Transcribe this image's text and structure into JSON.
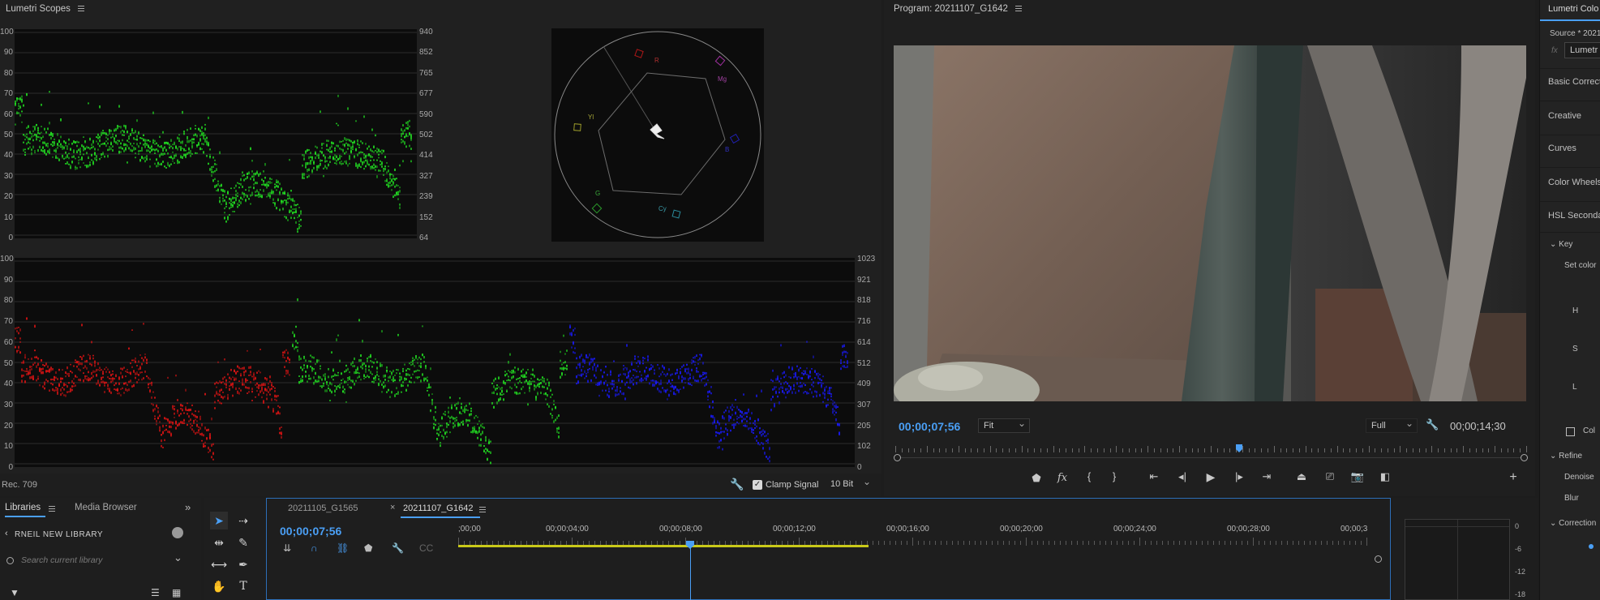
{
  "scopes": {
    "title": "Lumetri Scopes",
    "wave_left_labels": [
      "100",
      "90",
      "80",
      "70",
      "60",
      "50",
      "40",
      "30",
      "20",
      "10",
      "0"
    ],
    "wave_right_labels": [
      "940",
      "852",
      "765",
      "677",
      "590",
      "502",
      "414",
      "327",
      "239",
      "152",
      "64"
    ],
    "parade_left_labels": [
      "100",
      "90",
      "80",
      "70",
      "60",
      "50",
      "40",
      "30",
      "20",
      "10",
      "0"
    ],
    "parade_right_labels": [
      "1023",
      "921",
      "818",
      "716",
      "614",
      "512",
      "409",
      "307",
      "205",
      "102",
      "0"
    ],
    "vector_labels": {
      "r": "R",
      "mg": "Mg",
      "b": "B",
      "cy": "Cy",
      "g": "G",
      "yl": "Yl"
    },
    "footer_left": "Rec. 709",
    "clamp_signal_label": "Clamp Signal",
    "clamp_signal_checked": true,
    "bit_depth": "10 Bit"
  },
  "program": {
    "title": "Program: 20211107_G1642",
    "current_timecode": "00;00;07;56",
    "fit_value": "Fit",
    "quality_value": "Full",
    "duration": "00;00;14;30",
    "playhead_fraction": 0.545
  },
  "lumetri": {
    "title": "Lumetri Colo",
    "source": "Source * 2021",
    "fx_label": "fx",
    "effect_name": "Lumetr",
    "sections": [
      "Basic Correct",
      "Creative",
      "Curves",
      "Color Wheels",
      "HSL Secondar"
    ],
    "key_label": "Key",
    "set_color_label": "Set color",
    "hsl": [
      "H",
      "S",
      "L"
    ],
    "col_label": "Col",
    "refine_label": "Refine",
    "refine_items": [
      "Denoise",
      "Blur"
    ],
    "correction_label": "Correction"
  },
  "libraries": {
    "tab_libraries": "Libraries",
    "tab_media_browser": "Media Browser",
    "library_name": "RNEIL NEW LIBRARY",
    "search_placeholder": "Search current library"
  },
  "timeline": {
    "tab_inactive": "20211105_G1565",
    "tab_active": "20211107_G1642",
    "current_timecode": "00;00;07;56",
    "ruler_labels": [
      ";00;00",
      "00;00;04;00",
      "00;00;08;00",
      "00;00;12;00",
      "00;00;16;00",
      "00;00;20;00",
      "00;00;24;00",
      "00;00;28;00",
      "00;00;3"
    ]
  },
  "meter": {
    "labels": [
      "0",
      "-6",
      "-12",
      "-18"
    ]
  },
  "colors": {
    "accent_blue": "#4a9ff5",
    "wave_green": "#22e022",
    "wave_red": "#e61414",
    "wave_blue": "#1a1aff",
    "work_area_yellow": "#c9c919"
  }
}
